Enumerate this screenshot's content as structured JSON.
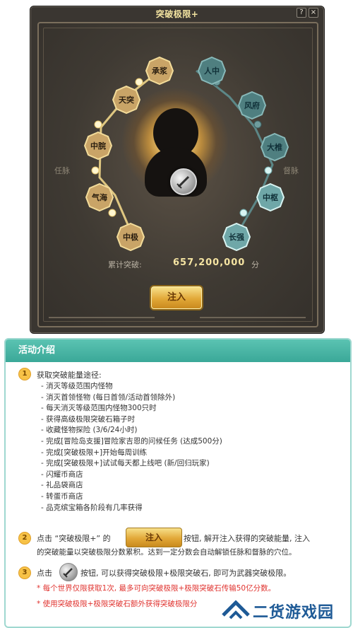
{
  "window": {
    "title": "突破极限+",
    "help_icon": "?",
    "close_icon": "×"
  },
  "meridians": {
    "left_label": "任脉",
    "right_label": "督脉",
    "left_nodes": [
      "承浆",
      "天突",
      "中脘",
      "气海",
      "中极"
    ],
    "right_nodes": [
      "人中",
      "风府",
      "大椎",
      "中枢",
      "长强"
    ]
  },
  "total": {
    "label": "累计突破:",
    "value": "657,200,000",
    "unit": "分"
  },
  "inject_button": "注入",
  "intro": {
    "title": "活动介绍",
    "section1": {
      "badge": "1",
      "title": "获取突破能量途径:",
      "items": [
        "- 消灭等级范围内怪物",
        "- 消灭首领怪物 (每日首领/活动首领除外)",
        "- 每天消灭等级范围内怪物300只时",
        "- 获得高级极限突破石箱子时",
        "- 收藏怪物探险 (3/6/24小时)",
        "- 完成[冒险岛支援]冒险家吉恩的问候任务 (达成500分)",
        "- 完成[突破极限+]开始每周训练",
        "- 完成[突破极限+]试试每天都上线吧 (新/回归玩家)",
        "- 闪耀币商店",
        "- 礼品袋商店",
        "- 转蛋币商店",
        "- 品克缤宝箱各阶段有几率获得"
      ]
    },
    "section2": {
      "badge": "2",
      "prefix": "点击 “突破极限+” 的",
      "button_label": "注入",
      "line1_suffix": "按钮, 解开注入获得的突破能量, 注入",
      "line2": "的突破能量以突破极限分数累积。达到一定分数会自动解锁任脉和督脉的穴位。"
    },
    "section3": {
      "badge": "3",
      "prefix": "点击",
      "suffix": "按钮, 可以获得突破极限+极限突破石, 即可为武器突破极限。",
      "note1": "* 每个世界仅限获取1次, 最多可向突破极限+极限突破石传输50亿分数。",
      "note2": "* 使用突破极限+极限突破石额外获得突破极限分"
    },
    "watermark": "二货游戏园"
  },
  "colors": {
    "gold_node": "#c9a467",
    "teal_node": "#6fa7a8",
    "accent_teal": "#3aa898",
    "red_note": "#e0332f"
  }
}
